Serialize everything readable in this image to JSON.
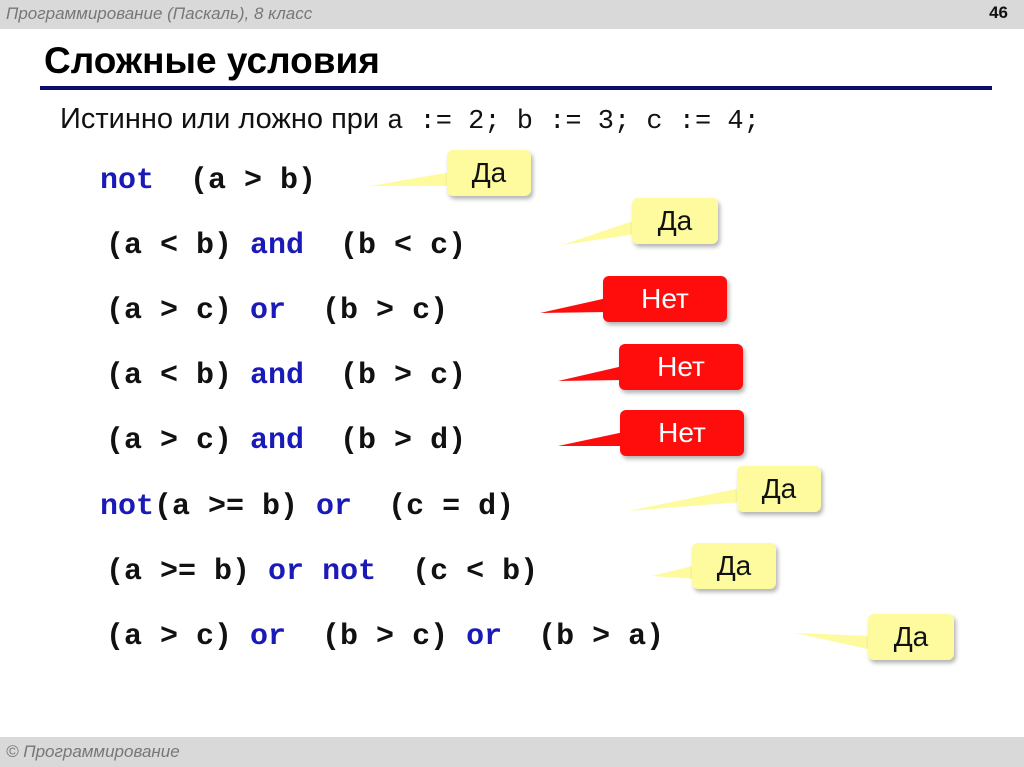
{
  "header": {
    "course": "Программирование (Паскаль), 8 класс",
    "page_number": "46"
  },
  "slide": {
    "title": "Сложные условия",
    "intro_text": "Истинно или ложно при ",
    "intro_code": "a := 2;  b := 3;  c := 4;",
    "answer_colors": {
      "yes": "#fdfb9d",
      "no": "#ff0d0d"
    },
    "rows": [
      {
        "parts": [
          {
            "t": "not",
            "kw": true
          },
          {
            "t": "  (a > b)",
            "kw": false
          }
        ],
        "answer": "Да",
        "result": "yes"
      },
      {
        "parts": [
          {
            "t": "(a < b) ",
            "kw": false
          },
          {
            "t": "and",
            "kw": true
          },
          {
            "t": "  (b < c)",
            "kw": false
          }
        ],
        "answer": "Да",
        "result": "yes"
      },
      {
        "parts": [
          {
            "t": "(a > c) ",
            "kw": false
          },
          {
            "t": "or",
            "kw": true
          },
          {
            "t": "  (b > c)",
            "kw": false
          }
        ],
        "answer": "Нет",
        "result": "no"
      },
      {
        "parts": [
          {
            "t": "(a < b) ",
            "kw": false
          },
          {
            "t": "and",
            "kw": true
          },
          {
            "t": "  (b > c)",
            "kw": false
          }
        ],
        "answer": "Нет",
        "result": "no"
      },
      {
        "parts": [
          {
            "t": "(a > c) ",
            "kw": false
          },
          {
            "t": "and",
            "kw": true
          },
          {
            "t": "  (b > d)",
            "kw": false
          }
        ],
        "answer": "Нет",
        "result": "no"
      },
      {
        "parts": [
          {
            "t": "not",
            "kw": true
          },
          {
            "t": "(a >= b) ",
            "kw": false
          },
          {
            "t": "or",
            "kw": true
          },
          {
            "t": "  (c = d)",
            "kw": false
          }
        ],
        "answer": "Да",
        "result": "yes"
      },
      {
        "parts": [
          {
            "t": "(a >= b) ",
            "kw": false
          },
          {
            "t": "or",
            "kw": true
          },
          {
            "t": " ",
            "kw": false
          },
          {
            "t": "not",
            "kw": true
          },
          {
            "t": "  (c < b)",
            "kw": false
          }
        ],
        "answer": "Да",
        "result": "yes"
      },
      {
        "parts": [
          {
            "t": "(a > c) ",
            "kw": false
          },
          {
            "t": "or",
            "kw": true
          },
          {
            "t": "  (b > c) ",
            "kw": false
          },
          {
            "t": "or",
            "kw": true
          },
          {
            "t": "  (b > a)",
            "kw": false
          }
        ],
        "answer": "Да",
        "result": "yes"
      }
    ]
  },
  "footer": {
    "copyright": "© Программирование"
  }
}
